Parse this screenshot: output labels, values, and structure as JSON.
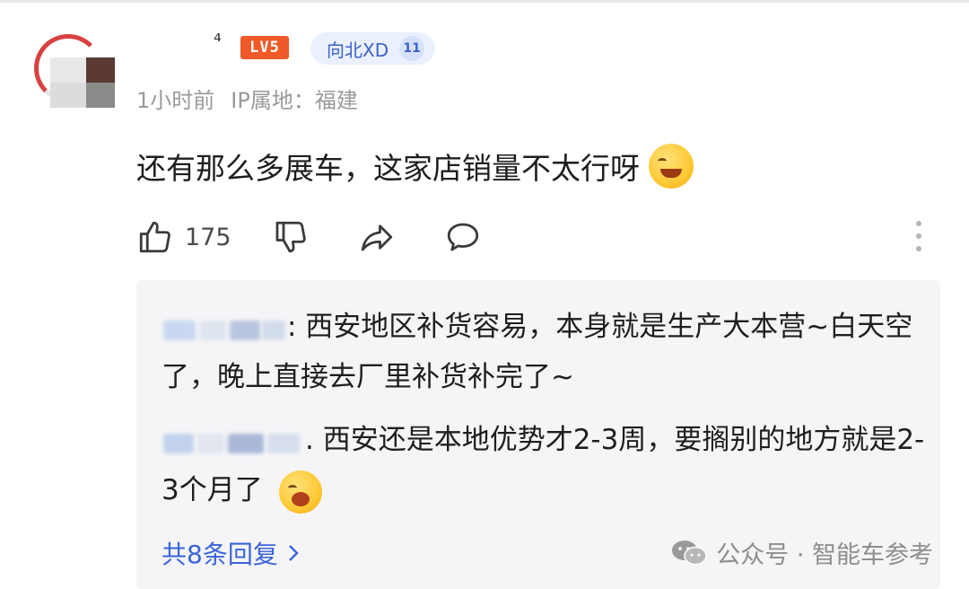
{
  "comment": {
    "username": "⁴",
    "level_badge": "LV5",
    "fan_badge": {
      "name": "向北XD",
      "level": "11"
    },
    "time": "1小时前",
    "ip_location": "IP属地：福建",
    "text": "还有那么多展车，这家店销量不太行呀",
    "like_count": "175"
  },
  "replies": [
    {
      "author": "",
      "text": ": 西安地区补货容易，本身就是生产大本营~白天空了，晚上直接去厂里补货补完了~"
    },
    {
      "author": "",
      "text": ". 西安还是本地优势才2-3周，要搁别的地方就是2-3个月了"
    }
  ],
  "more_replies_label": "共8条回复",
  "watermark": "公众号 · 智能车参考",
  "colors": {
    "accent_blue": "#3a64d8",
    "level_orange": "#f05a28",
    "fan_chip_bg": "#eaf0fd",
    "reply_bg": "#f5f5f7"
  },
  "icons": [
    "thumbs-up-icon",
    "thumbs-down-icon",
    "share-icon",
    "comment-icon",
    "more-vertical-icon",
    "chevron-right-icon",
    "wechat-icon"
  ]
}
